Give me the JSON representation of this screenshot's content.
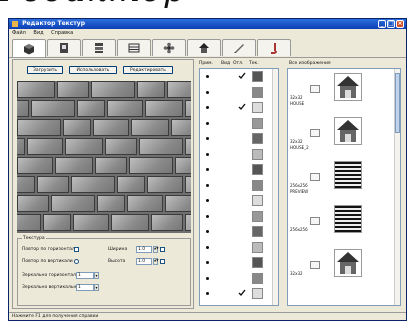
{
  "header_text": "Редактор",
  "window": {
    "title": "Редактор Текстур",
    "controls": [
      "_",
      "□",
      "×"
    ]
  },
  "menu": [
    "Файл",
    "Вид",
    "Справка"
  ],
  "tabs": [
    {
      "icon": "cube-icon"
    },
    {
      "icon": "door-icon"
    },
    {
      "icon": "stack-icon"
    },
    {
      "icon": "panel-icon"
    },
    {
      "icon": "flower-icon"
    },
    {
      "icon": "roof-icon"
    },
    {
      "icon": "brush-icon"
    },
    {
      "icon": "pipe-icon"
    }
  ],
  "texture_panel": {
    "buttons": [
      "Загрузить",
      "Использовать",
      "Редактировать"
    ]
  },
  "texture_group": {
    "title": "Текстура",
    "repeat_h_label": "Повтор по горизонтали",
    "repeat_v_label": "Повтор по вертикали",
    "flip_h_label": "Зеркально горизонтально",
    "flip_v_label": "Зеркально вертикально",
    "width_label": "Ширина",
    "height_label": "Высота",
    "width_value": "1.0",
    "height_value": "1.0",
    "repeat_h_value": "1",
    "repeat_v_value": "1"
  },
  "list": {
    "headers": [
      "Прим.",
      "Вид",
      "Отл.",
      "Тек."
    ],
    "rows": [
      {
        "checked": false,
        "tick": true
      },
      {
        "checked": false,
        "tick": false
      },
      {
        "checked": false,
        "tick": true
      },
      {
        "checked": false,
        "tick": false
      },
      {
        "checked": false,
        "tick": false
      },
      {
        "checked": false,
        "tick": false
      },
      {
        "checked": false,
        "tick": false
      },
      {
        "checked": false,
        "tick": false
      },
      {
        "checked": false,
        "tick": false
      },
      {
        "checked": false,
        "tick": false
      },
      {
        "checked": false,
        "tick": false
      },
      {
        "checked": false,
        "tick": false
      },
      {
        "checked": false,
        "tick": false
      },
      {
        "checked": false,
        "tick": false
      },
      {
        "checked": false,
        "tick": true
      }
    ]
  },
  "images": {
    "title": "Все изображения",
    "items": [
      {
        "size": "32x32",
        "name": "HOUSE"
      },
      {
        "size": "32x32",
        "name": "HOUSE_2"
      },
      {
        "size": "256x256",
        "name": "PREVIEW"
      },
      {
        "size": "256x256",
        "name": ""
      },
      {
        "size": "32x32",
        "name": ""
      }
    ]
  },
  "status": "Нажмите F1 для получения справки"
}
